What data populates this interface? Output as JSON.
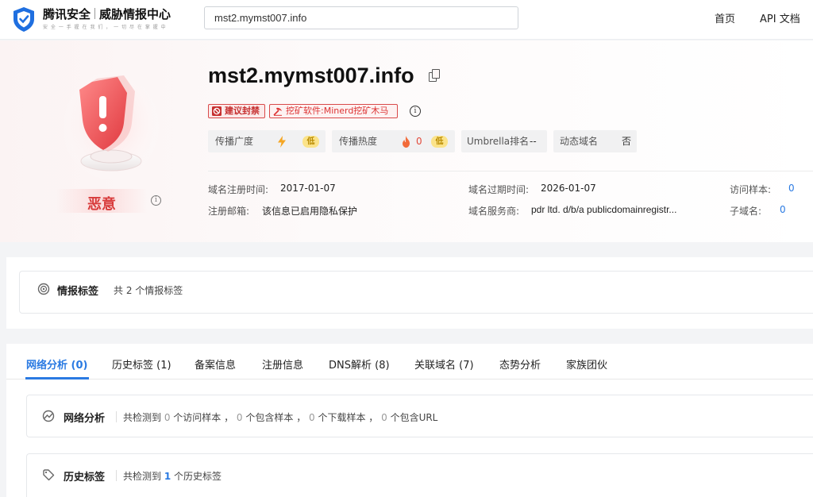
{
  "header": {
    "logo_name": "腾讯安全",
    "logo_product": "威胁情报中心",
    "logo_slogan": "安 全 一 手 握 在 我 们 ， 一 切 尽 在 掌 握 中",
    "search_value": "mst2.mymst007.info",
    "nav": [
      "首页",
      "API 文档"
    ]
  },
  "summary": {
    "verdict": "恶意",
    "domain": "mst2.mymst007.info",
    "tags": {
      "ban": "建议封禁",
      "malware": "挖矿软件:Minerd挖矿木马"
    },
    "metrics": {
      "spread_label": "传播广度",
      "spread_level": "低",
      "heat_label": "传播热度",
      "heat_count": "0",
      "heat_level": "低",
      "umbrella_label": "Umbrella排名",
      "umbrella_value": "--",
      "dynamic_label": "动态域名",
      "dynamic_value": "否"
    },
    "info": {
      "reg_time_label": "域名注册时间:",
      "reg_time": "2017-01-07",
      "expire_label": "域名过期时间:",
      "expire_time": "2026-01-07",
      "visit_label": "访问样本:",
      "visit_count": "0",
      "email_label": "注册邮箱:",
      "email_value": "该信息已启用隐私保护",
      "registrar_label": "域名服务商:",
      "registrar_value": "pdr ltd. d/b/a publicdomainregistr...",
      "subdomain_label": "子域名:",
      "subdomain_count": "0"
    }
  },
  "intel": {
    "title": "情报标签",
    "desc": "共 2 个情报标签"
  },
  "tabs": [
    "网络分析 (0)",
    "历史标签 (1)",
    "备案信息",
    "注册信息",
    "DNS解析 (8)",
    "关联域名 (7)",
    "态势分析",
    "家族团伙"
  ],
  "network": {
    "title": "网络分析",
    "p1": "共检测到 ",
    "n1": "0",
    "p2": " 个访问样本 ， ",
    "n2": "0",
    "p3": " 个包含样本 ， ",
    "n3": "0",
    "p4": " 个下载样本 ， ",
    "n4": "0",
    "p5": " 个包含URL"
  },
  "history": {
    "title": "历史标签",
    "p1": "共检测到 ",
    "n1": "1",
    "p2": " 个历史标签"
  },
  "colors": {
    "accent": "#2a7ae2",
    "danger": "#d83b3b",
    "warning_badge": "#fbe38a"
  }
}
